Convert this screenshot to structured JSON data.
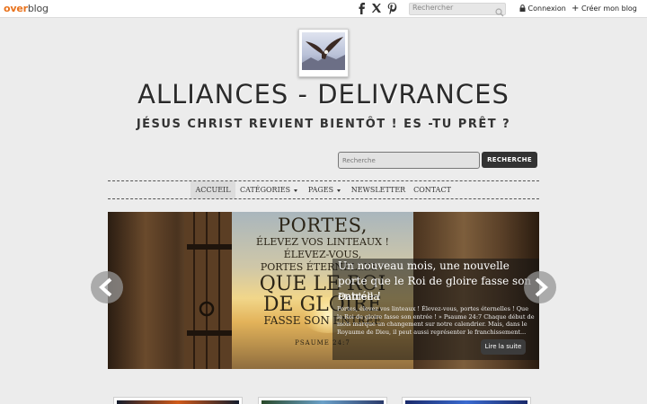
{
  "topbar": {
    "logo_part1": "over",
    "logo_part2": "blog",
    "search_placeholder": "Rechercher",
    "login_label": "Connexion",
    "create_label": "Créer mon blog",
    "social_icons": [
      "facebook-icon",
      "x-icon",
      "pinterest-icon"
    ]
  },
  "header": {
    "title": "ALLIANCES - DELIVRANCES",
    "subtitle": "JÉSUS CHRIST REVIENT BIENTÔT ! ES -TU PRÊT ?"
  },
  "search": {
    "placeholder": "Recherche",
    "button_label": "RECHERCHE"
  },
  "nav": {
    "items": [
      {
        "label": "ACCUEIL",
        "active": true,
        "has_dropdown": false
      },
      {
        "label": "CATÉGORIES",
        "active": false,
        "has_dropdown": true
      },
      {
        "label": "PAGES",
        "active": false,
        "has_dropdown": true
      },
      {
        "label": "NEWSLETTER",
        "active": false,
        "has_dropdown": false
      },
      {
        "label": "CONTACT",
        "active": false,
        "has_dropdown": false
      }
    ]
  },
  "slider": {
    "image_lines": [
      "PORTES,",
      "ÉLEVEZ VOS LINTEAUX !",
      "ÉLEVEZ-VOUS,",
      "PORTES ÉTERNELLES !",
      "QUE LE ROI",
      "DE GLOIRE",
      "FASSE SON ENTRÉE",
      "PSAUME 24:7"
    ],
    "caption_title": "Un nouveau mois, une nouvelle porte que le Roi de gloire fasse son entrée !",
    "caption_author": "Daniella",
    "caption_text": "Portes, élevez vos linteaux ! Élevez-vous, portes éternelles ! Que le Roi de gloire fasse son entrée ! » Psaume 24:7 Chaque début de mois marque un changement sur notre calendrier. Mais, dans le Royaume de Dieu, il peut aussi représenter le franchissement...",
    "read_more_label": "Lire la suite"
  },
  "colors": {
    "brand_orange": "#e9731d",
    "button_dark": "#333333",
    "background": "#ececec"
  }
}
